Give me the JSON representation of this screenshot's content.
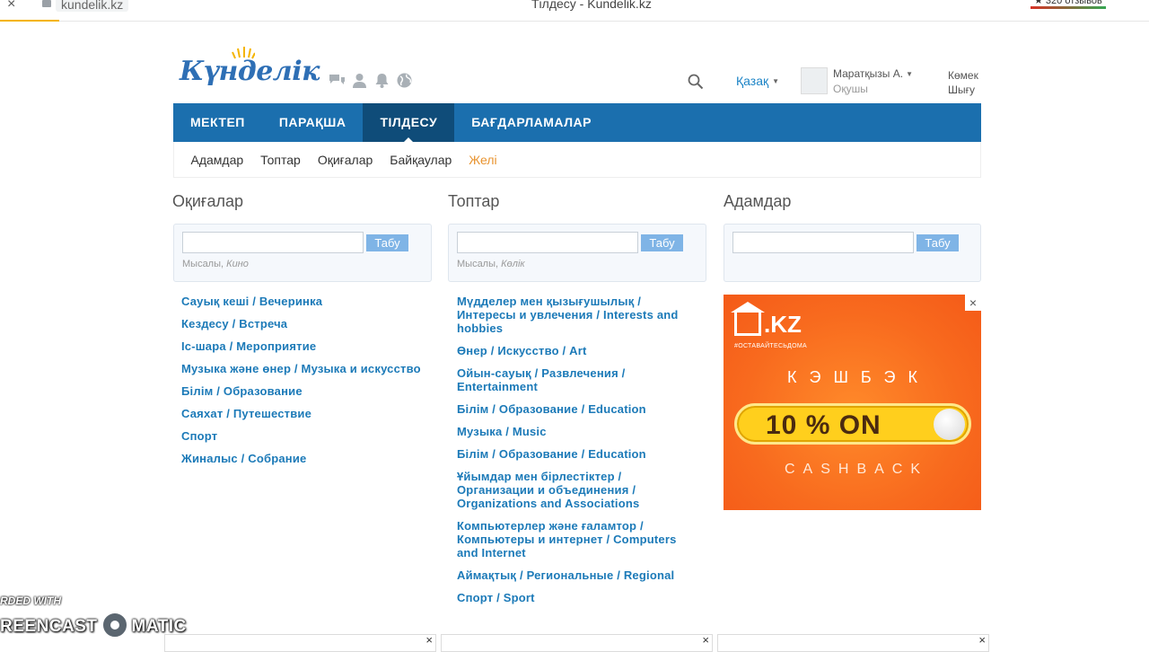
{
  "browser": {
    "close_glyph": "×",
    "url": "kundelik.kz",
    "tab_title": "Тілдесу - Kundelik.kz",
    "rating": "★ 320 отзывов"
  },
  "header": {
    "logo_text": "Күнделік",
    "language": "Қазақ",
    "user_name": "Маратқызы А.",
    "user_role": "Оқушы",
    "help": "Көмек",
    "logout": "Шығу",
    "icons": [
      "chat-icon",
      "person-icon",
      "bell-icon",
      "globe-icon",
      "search-icon"
    ]
  },
  "nav": {
    "items": [
      "МЕКТЕП",
      "ПАРАҚША",
      "ТІЛДЕСУ",
      "БАҒДАРЛАМАЛАР"
    ],
    "active_index": 2
  },
  "subnav": {
    "items": [
      "Адамдар",
      "Топтар",
      "Оқиғалар",
      "Байқаулар",
      "Желі"
    ],
    "active_index": 4
  },
  "events": {
    "title": "Оқиғалар",
    "search_button": "Табу",
    "example_label": "Мысалы,",
    "example_value": "Кино",
    "links": [
      "Сауық кеші / Вечеринка",
      "Кездесу / Встреча",
      "Іс-шара / Мероприятие",
      "Музыка және өнер / Музыка и искусство",
      "Білім / Образование",
      "Саяхат / Путешествие",
      "Спорт",
      "Жиналыс / Собрание"
    ]
  },
  "groups": {
    "title": "Топтар",
    "search_button": "Табу",
    "example_label": "Мысалы,",
    "example_value": "Көлік",
    "links": [
      "Мүдделер мен қызығушылық / Интересы и увлечения / Interests and hobbies",
      "Өнер / Искусство / Art",
      "Ойын-сауық / Развлечения / Entertainment",
      "Білім / Образование / Education",
      "Музыка / Music",
      "Білім / Образование / Education",
      "Ұйымдар мен бірлестіктер / Организации и объединения / Organizations and Associations",
      "Компьютерлер және ғаламтор / Компьютеры и интернет / Computers and Internet",
      "Аймақтық / Региональные / Regional",
      "Спорт / Sport"
    ]
  },
  "people": {
    "title": "Адамдар",
    "search_button": "Табу"
  },
  "ad": {
    "close": "×",
    "logo": ".KZ",
    "tagline": "#ОСТАВАЙТЕСЬДОМА",
    "headline": "КЭШБЭК",
    "pill_text": "10 % ON",
    "footer": "CASHBACK",
    "colors": {
      "bg": "#f86a1e",
      "pill": "#ffcf1d"
    }
  },
  "watermark": {
    "line1": "RDED WITH",
    "line2_left": "REENCAST",
    "line2_right": "MATIC"
  },
  "bottom_close": "×"
}
